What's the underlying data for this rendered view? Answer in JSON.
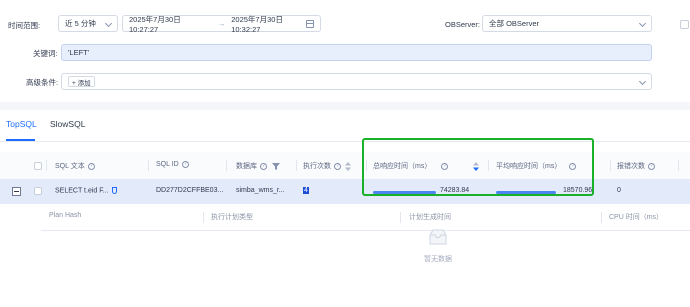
{
  "filters": {
    "time_range_label": "时间范围:",
    "time_preset": "近 5 分钟",
    "start_time": "2025年7月30日 10:27:27",
    "range_arrow": "→",
    "end_time": "2025年7月30日 10:32:27",
    "observer_label": "OBServer:",
    "observer_value": "全部 OBServer",
    "keyword_label": "关键词:",
    "keyword_value": "'LEFT'",
    "advanced_label": "高级条件:",
    "add_label": "+ 添加"
  },
  "tabs": [
    {
      "label": "TopSQL",
      "active": true
    },
    {
      "label": "SlowSQL",
      "active": false
    }
  ],
  "table": {
    "columns": {
      "sql_text": "SQL 文本",
      "sql_id": "SQL ID",
      "database": "数据库",
      "exec_count": "执行次数",
      "total_resp": "总响应时间（ms）",
      "avg_resp": "平均响应时间（ms）",
      "error_count": "报错次数"
    },
    "row": {
      "sql_text": "SELECT t.eid F...",
      "sql_id": "DD277D2CFFBE03...",
      "database": "simba_wms_r...",
      "exec_count": "4",
      "total_resp": "74283.84",
      "total_resp_fraction": 1.0,
      "avg_resp": "18570.96",
      "avg_resp_fraction": 1.0,
      "error_count": "0"
    },
    "sub_columns": {
      "plan_hash": "Plan Hash",
      "plan_type": "执行计划类型",
      "plan_time": "计划生成时间",
      "cpu_time": "CPU 时间（ms）"
    },
    "empty_text": "暂无数据"
  },
  "colors": {
    "accent": "#1d6bff",
    "row_highlight": "#e3ebfb",
    "bar": "#4b85ef",
    "annotation": "#19b12a"
  }
}
